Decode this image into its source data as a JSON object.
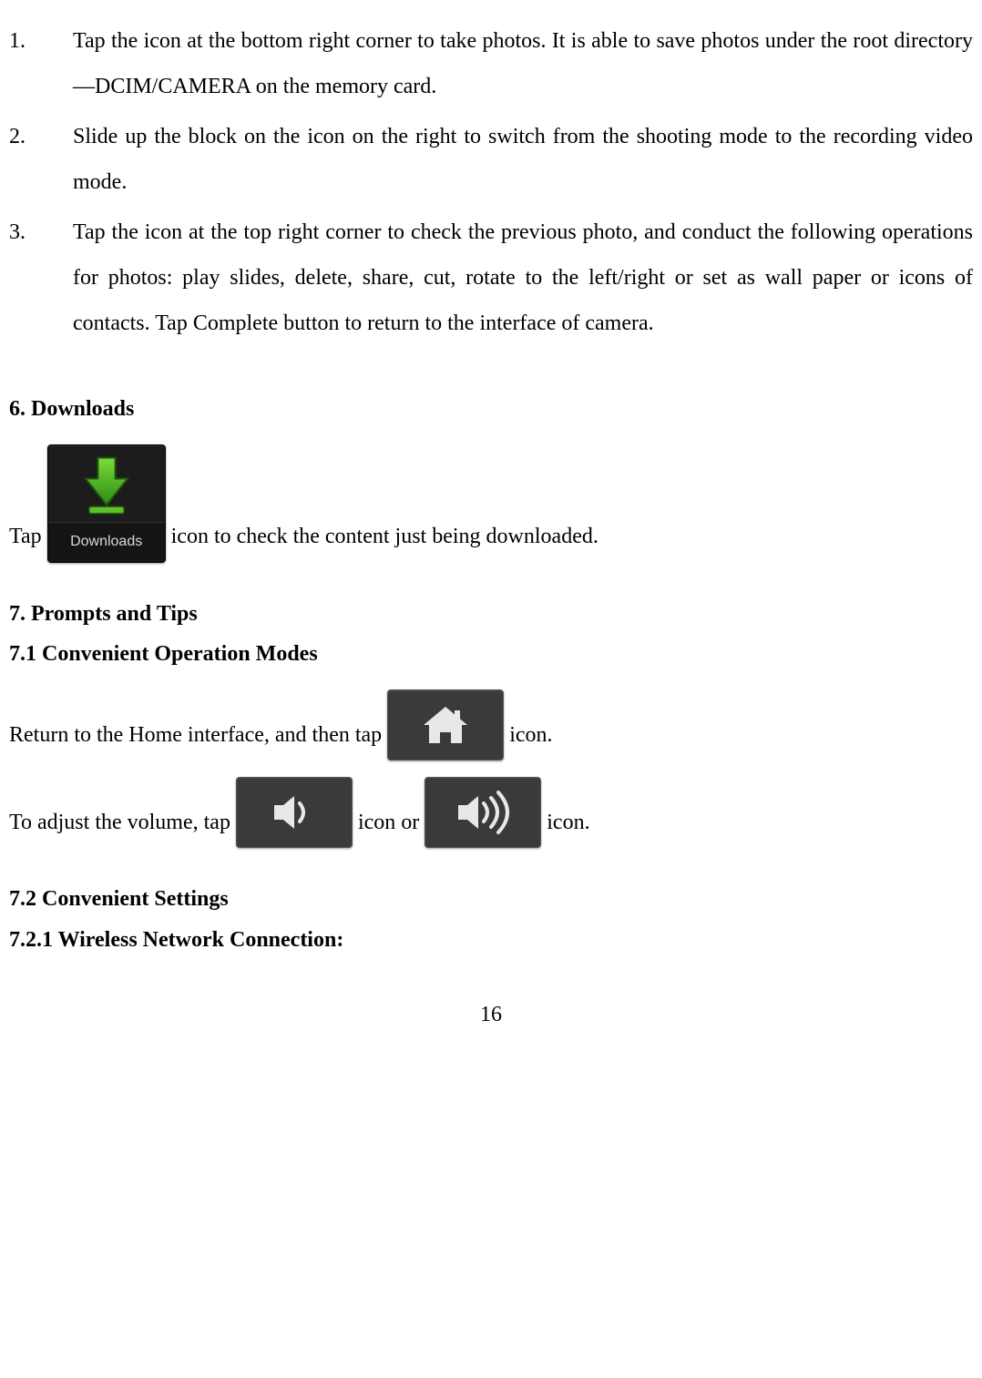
{
  "list": {
    "items": [
      {
        "num": "1.",
        "text": "Tap the icon at the bottom right corner to take photos. It is able to save photos under the root directory—DCIM/CAMERA on the memory card."
      },
      {
        "num": "2.",
        "text": "Slide up the block on the icon on the right to switch from the shooting mode to the recording video mode."
      },
      {
        "num": "3.",
        "text": "Tap the icon at the top right corner to check the previous photo, and conduct the following operations for photos: play slides, delete, share, cut, rotate to the left/right or set as wall paper or icons of contacts. Tap Complete button to return to the interface of camera."
      }
    ]
  },
  "sections": {
    "downloads": {
      "heading": "6. Downloads",
      "pre": "Tap",
      "icon_label": "Downloads",
      "post": "icon to check the content just being downloaded."
    },
    "prompts": {
      "heading": "7. Prompts and Tips",
      "sub1": "7.1 Convenient Operation Modes",
      "home_pre": "Return to the Home interface, and then tap",
      "home_post": "icon.",
      "vol_pre": "To adjust the volume, tap",
      "vol_mid": "icon or",
      "vol_post": "icon.",
      "sub2": "7.2 Convenient Settings",
      "sub2_1": "7.2.1 Wireless Network Connection:"
    }
  },
  "page_number": "16"
}
